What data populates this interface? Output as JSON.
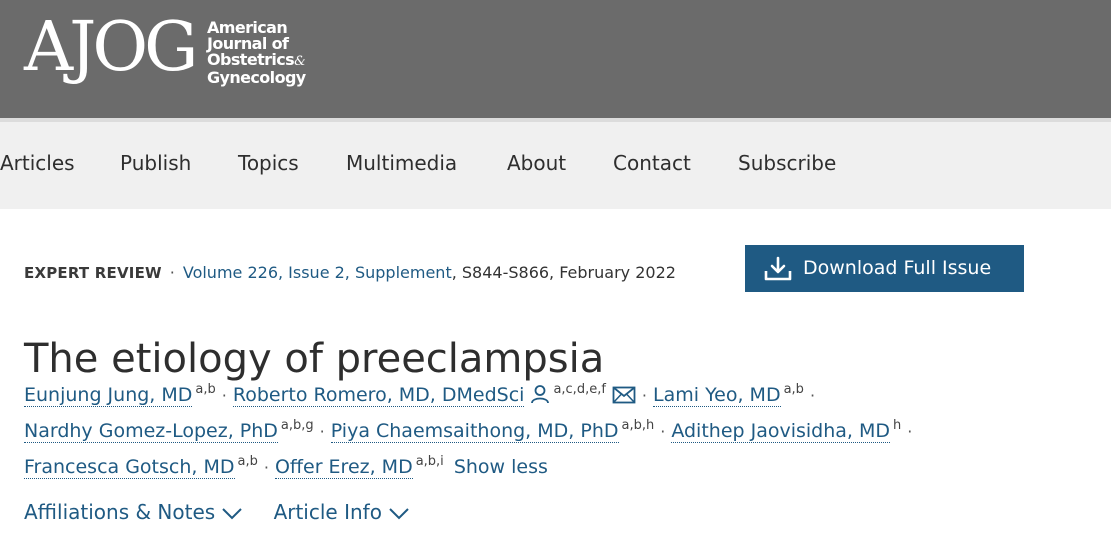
{
  "header": {
    "logo_mark": "AJOG",
    "logo_lines": [
      "American",
      "Journal of",
      "Obstetrics",
      "Gynecology"
    ],
    "logo_amp": "&"
  },
  "nav": {
    "items": [
      {
        "label": "Articles"
      },
      {
        "label": "Publish"
      },
      {
        "label": "Topics"
      },
      {
        "label": "Multimedia"
      },
      {
        "label": "About"
      },
      {
        "label": "Contact"
      },
      {
        "label": "Subscribe"
      }
    ]
  },
  "article": {
    "type": "EXPERT REVIEW",
    "volume_link": "Volume 226, Issue 2, Supplement",
    "pages_date": ", S844-S866, February 2022",
    "download_label": "Download Full Issue",
    "title": "The etiology of preeclampsia",
    "authors": [
      {
        "name": "Eunjung Jung, MD",
        "sup": "a,b"
      },
      {
        "name": "Roberto Romero, MD, DMedSci",
        "sup": "a,c,d,e,f"
      },
      {
        "name": "Lami Yeo, MD",
        "sup": "a,b"
      },
      {
        "name": "Nardhy Gomez-Lopez, PhD",
        "sup": "a,b,g"
      },
      {
        "name": "Piya Chaemsaithong, MD, PhD",
        "sup": "a,b,h"
      },
      {
        "name": "Adithep Jaovisidha, MD",
        "sup": "h"
      },
      {
        "name": "Francesca Gotsch, MD",
        "sup": "a,b"
      },
      {
        "name": "Offer Erez, MD",
        "sup": "a,b,i"
      }
    ],
    "show_less": "Show less",
    "affiliations_label": "Affiliations & Notes",
    "article_info_label": "Article Info"
  },
  "colors": {
    "header_bg": "#6b6b6b",
    "nav_bg": "#f0f0f0",
    "link": "#1f5a83",
    "button_bg": "#1f5a83"
  },
  "icons": [
    "download-icon",
    "person-icon",
    "envelope-icon",
    "chevron-down-icon"
  ]
}
